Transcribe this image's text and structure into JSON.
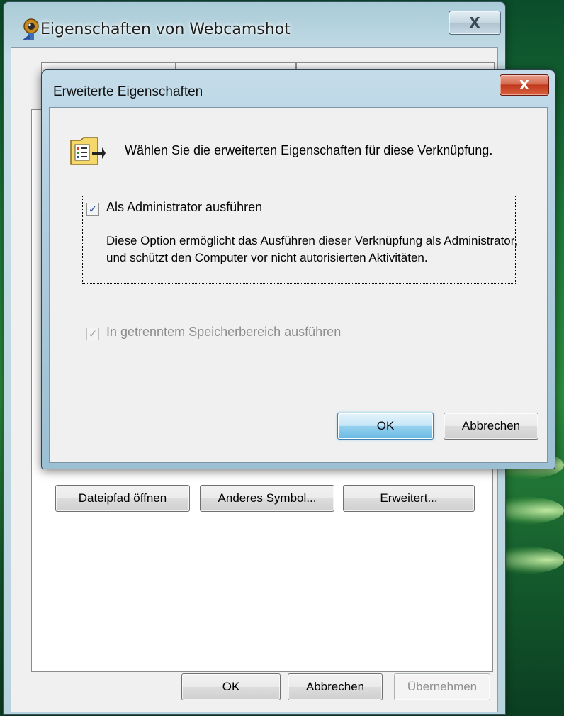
{
  "main_window": {
    "title": "Eigenschaften von Webcamshot",
    "close_glyph": "X",
    "buttons": {
      "open_path": "Dateipfad öffnen",
      "change_icon": "Anderes Symbol...",
      "advanced": "Erweitert...",
      "ok": "OK",
      "cancel": "Abbrechen",
      "apply": "Übernehmen"
    }
  },
  "dialog": {
    "title": "Erweiterte Eigenschaften",
    "close_glyph": "X",
    "heading": "Wählen Sie die erweiterten Eigenschaften für diese Verknüpfung.",
    "run_as_admin": {
      "label": "Als Administrator ausführen",
      "checked": true
    },
    "description": "Diese Option ermöglicht das Ausführen dieser Verknüpfung als Administrator, und schützt den Computer vor nicht autorisierten Aktivitäten.",
    "separate_memory": {
      "label": "In getrenntem Speicherbereich ausführen",
      "checked": true,
      "disabled": true
    },
    "buttons": {
      "ok": "OK",
      "cancel": "Abbrechen"
    }
  },
  "icons": {
    "window_icon": "webcam-app-icon",
    "dialog_icon": "shortcut-properties-icon",
    "check_glyph": "✓"
  },
  "colors": {
    "default_button": "#98d1ef",
    "dialog_close": "#c0381d"
  }
}
